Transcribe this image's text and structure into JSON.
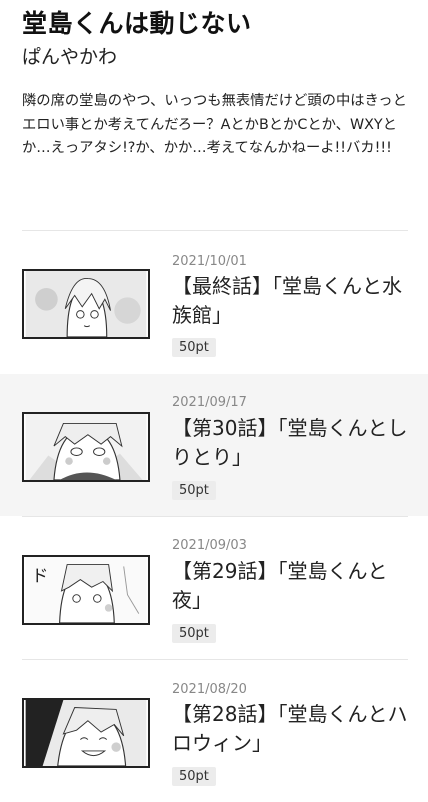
{
  "series": {
    "title": "堂島くんは動じない",
    "author": "ぱんやかわ",
    "description": "隣の席の堂島のやつ、いっつも無表情だけど頭の中はきっとエロい事とか考えてんだろー？AとかBとかCとか、WXYとか…えっアタシ!?か、かか…考えてなんかねーよ!!バカ!!!"
  },
  "episodes": [
    {
      "date": "2021/10/01",
      "title": "【最終話】「堂島くんと水族館」",
      "price": "50pt",
      "thumb_icon": "manga-thumbnail-icon"
    },
    {
      "date": "2021/09/17",
      "title": "【第30話】「堂島くんとしりとり」",
      "price": "50pt",
      "thumb_icon": "manga-thumbnail-icon"
    },
    {
      "date": "2021/09/03",
      "title": "【第29話】「堂島くんと夜」",
      "price": "50pt",
      "thumb_icon": "manga-thumbnail-icon"
    },
    {
      "date": "2021/08/20",
      "title": "【第28話】「堂島くんとハロウィン」",
      "price": "50pt",
      "thumb_icon": "manga-thumbnail-icon"
    }
  ],
  "colors": {
    "alt_row": "#f5f5f5",
    "badge_bg": "#ececec",
    "date_text": "#888888"
  }
}
